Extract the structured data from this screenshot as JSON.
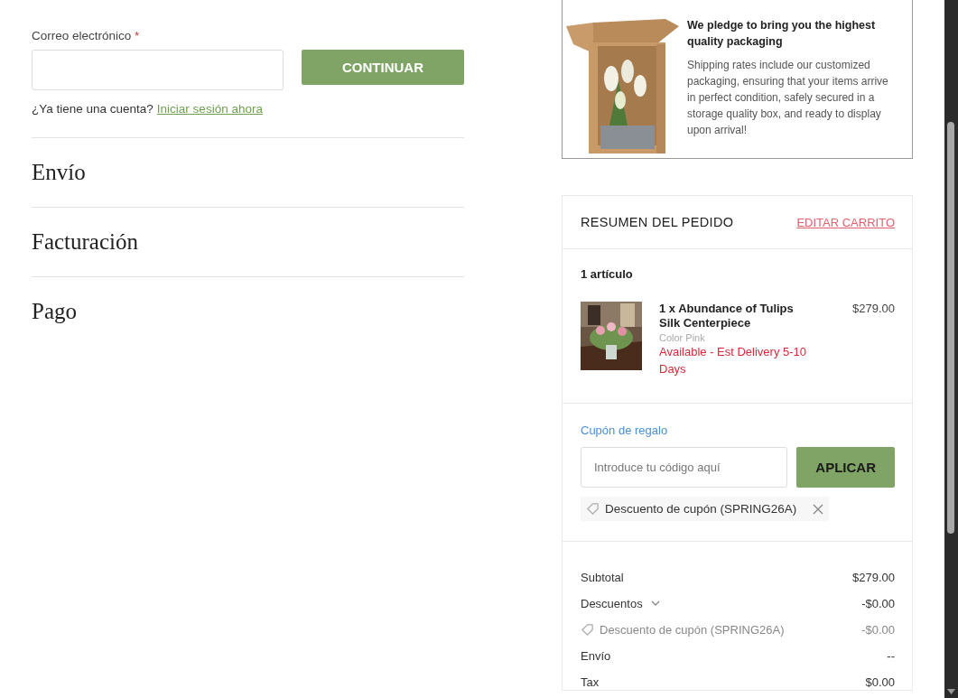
{
  "customer": {
    "email_label": "Correo electrónico",
    "required_mark": "*",
    "continue_button": "CONTINUAR",
    "account_prompt": "¿Ya tiene una cuenta?",
    "login_link": "Iniciar sesión ahora"
  },
  "sections": [
    {
      "title": "Envío"
    },
    {
      "title": "Facturación"
    },
    {
      "title": "Pago"
    }
  ],
  "packaging": {
    "title": "We pledge to bring you the highest quality packaging",
    "body": "Shipping rates include our customized packaging, ensuring that your items arrive in perfect condition, safely secured in a storage quality box, and ready to display upon arrival!"
  },
  "summary": {
    "title": "RESUMEN DEL PEDIDO",
    "edit_link": "EDITAR CARRITO",
    "item_count": "1 artículo",
    "items": [
      {
        "name": "1 x Abundance of Tulips Silk Centerpiece",
        "option": "Color Pink",
        "availability": "Available - Est Delivery 5-10 Days",
        "price": "$279.00"
      }
    ],
    "coupon": {
      "label": "Cupón de regalo",
      "placeholder": "Introduce tu código aquí",
      "apply_button": "APLICAR",
      "applied": "Descuento de cupón (SPRING26A)"
    },
    "totals": [
      {
        "kind": "plain",
        "label": "Subtotal",
        "value": "$279.00"
      },
      {
        "kind": "expandable",
        "label": "Descuentos",
        "value": "-$0.00"
      },
      {
        "kind": "coupon",
        "label": "Descuento de cupón (SPRING26A)",
        "value": "-$0.00"
      },
      {
        "kind": "plain",
        "label": "Envío",
        "value": "--"
      },
      {
        "kind": "plain",
        "label": "Tax",
        "value": "$0.00"
      }
    ]
  }
}
